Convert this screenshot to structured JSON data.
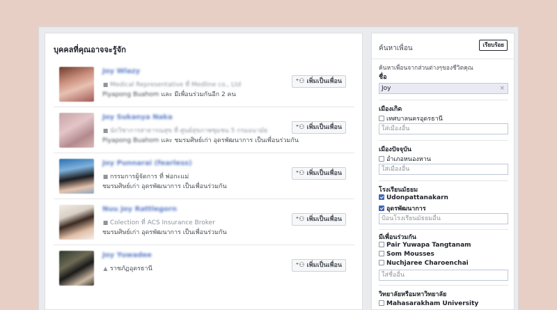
{
  "people_you_may_know": {
    "title": "บุคคลที่คุณอาจจะรู้จัก",
    "add_label": "เพิ่มเป็นเพื่อน",
    "people": [
      {
        "name": "Joy Wlazy",
        "work": "Medical Representative ที่ Medline co., Ltd",
        "mutual_blur": "Piyapong Buahom",
        "mutual_text": " และ มีเพื่อนร่วมกันอีก 2 คน",
        "name_blurred": true,
        "work_blurred": true,
        "work_icon": "briefcase-icon"
      },
      {
        "name": "Joy Sukanya Naka",
        "work": "นักวิชาการสาธารณสุข ที่ ศูนย์สุขภาพชุมชน 5 กรมอนามัย",
        "mutual_blur": "Piyapong Buahom",
        "mutual_text": " และ ชมรมศิษย์เก่า อุดรพัฒนาการ เป็นเพื่อนร่วมกัน",
        "name_blurred": true,
        "work_blurred": true,
        "work_icon": "briefcase-icon"
      },
      {
        "name": "Joy Punnarai (fearless)",
        "work": "กรรมการผู้จัดการ ที่ พ่อกะแม่",
        "mutual_blur": "",
        "mutual_text": "ชมรมศิษย์เก่า อุดรพัฒนาการ เป็นเพื่อนร่วมกัน",
        "name_blurred": true,
        "work_blurred": false,
        "work_icon": "briefcase-icon"
      },
      {
        "name": "Nuu Joy Rattlegorn",
        "work": "Colection ที่ ACS Insurance Broker",
        "mutual_blur": "",
        "mutual_text": "ชมรมศิษย์เก่า อุดรพัฒนาการ เป็นเพื่อนร่วมกัน",
        "name_blurred": true,
        "work_blurred": "partial",
        "work_icon": "briefcase-icon"
      },
      {
        "name": "Joy Yuwadee",
        "work": "ราชภัฏอุดรธานี",
        "mutual_blur": "",
        "mutual_text": "",
        "name_blurred": true,
        "work_blurred": false,
        "work_icon": "graduation-cap-icon"
      }
    ]
  },
  "friend_search": {
    "title": "ค้นหาเพื่อน",
    "done_label": "เรียบร้อย",
    "description": "ค้นหาเพื่อนจากส่วนต่างๆของชีวิตคุณ",
    "name_label": "ชื่อ",
    "name_value": "Joy",
    "clear_icon": "×",
    "hometown_label": "เมืองเกิด",
    "hometown_option": "เทศบาลนครอุดรธานี",
    "hometown_placeholder": "ใส่เมืองอื่น",
    "current_city_label": "เมืองปัจจุบัน",
    "current_city_option": "อำเภอหนองหาน",
    "current_city_placeholder": "ใส่เมืองอื่น",
    "high_school_label": "โรงเรียนมัธยม",
    "high_school_options": [
      "Udonpattanakarn",
      "อุดรพัฒนาการ"
    ],
    "high_school_placeholder": "ป้อนโรงเรียนมัธยมอื่น",
    "mutual_label": "มีเพื่อนร่วมกัน",
    "mutual_options": [
      "Pair Yuwapa Tangtanam",
      "Som Mousses",
      "Nuchjaree Charoenchai"
    ],
    "mutual_placeholder": "ใส่ชื่ออื่น",
    "college_label": "วิทยาลัยหรือมหาวิทยาลัย",
    "college_option": "Mahasarakham University"
  }
}
